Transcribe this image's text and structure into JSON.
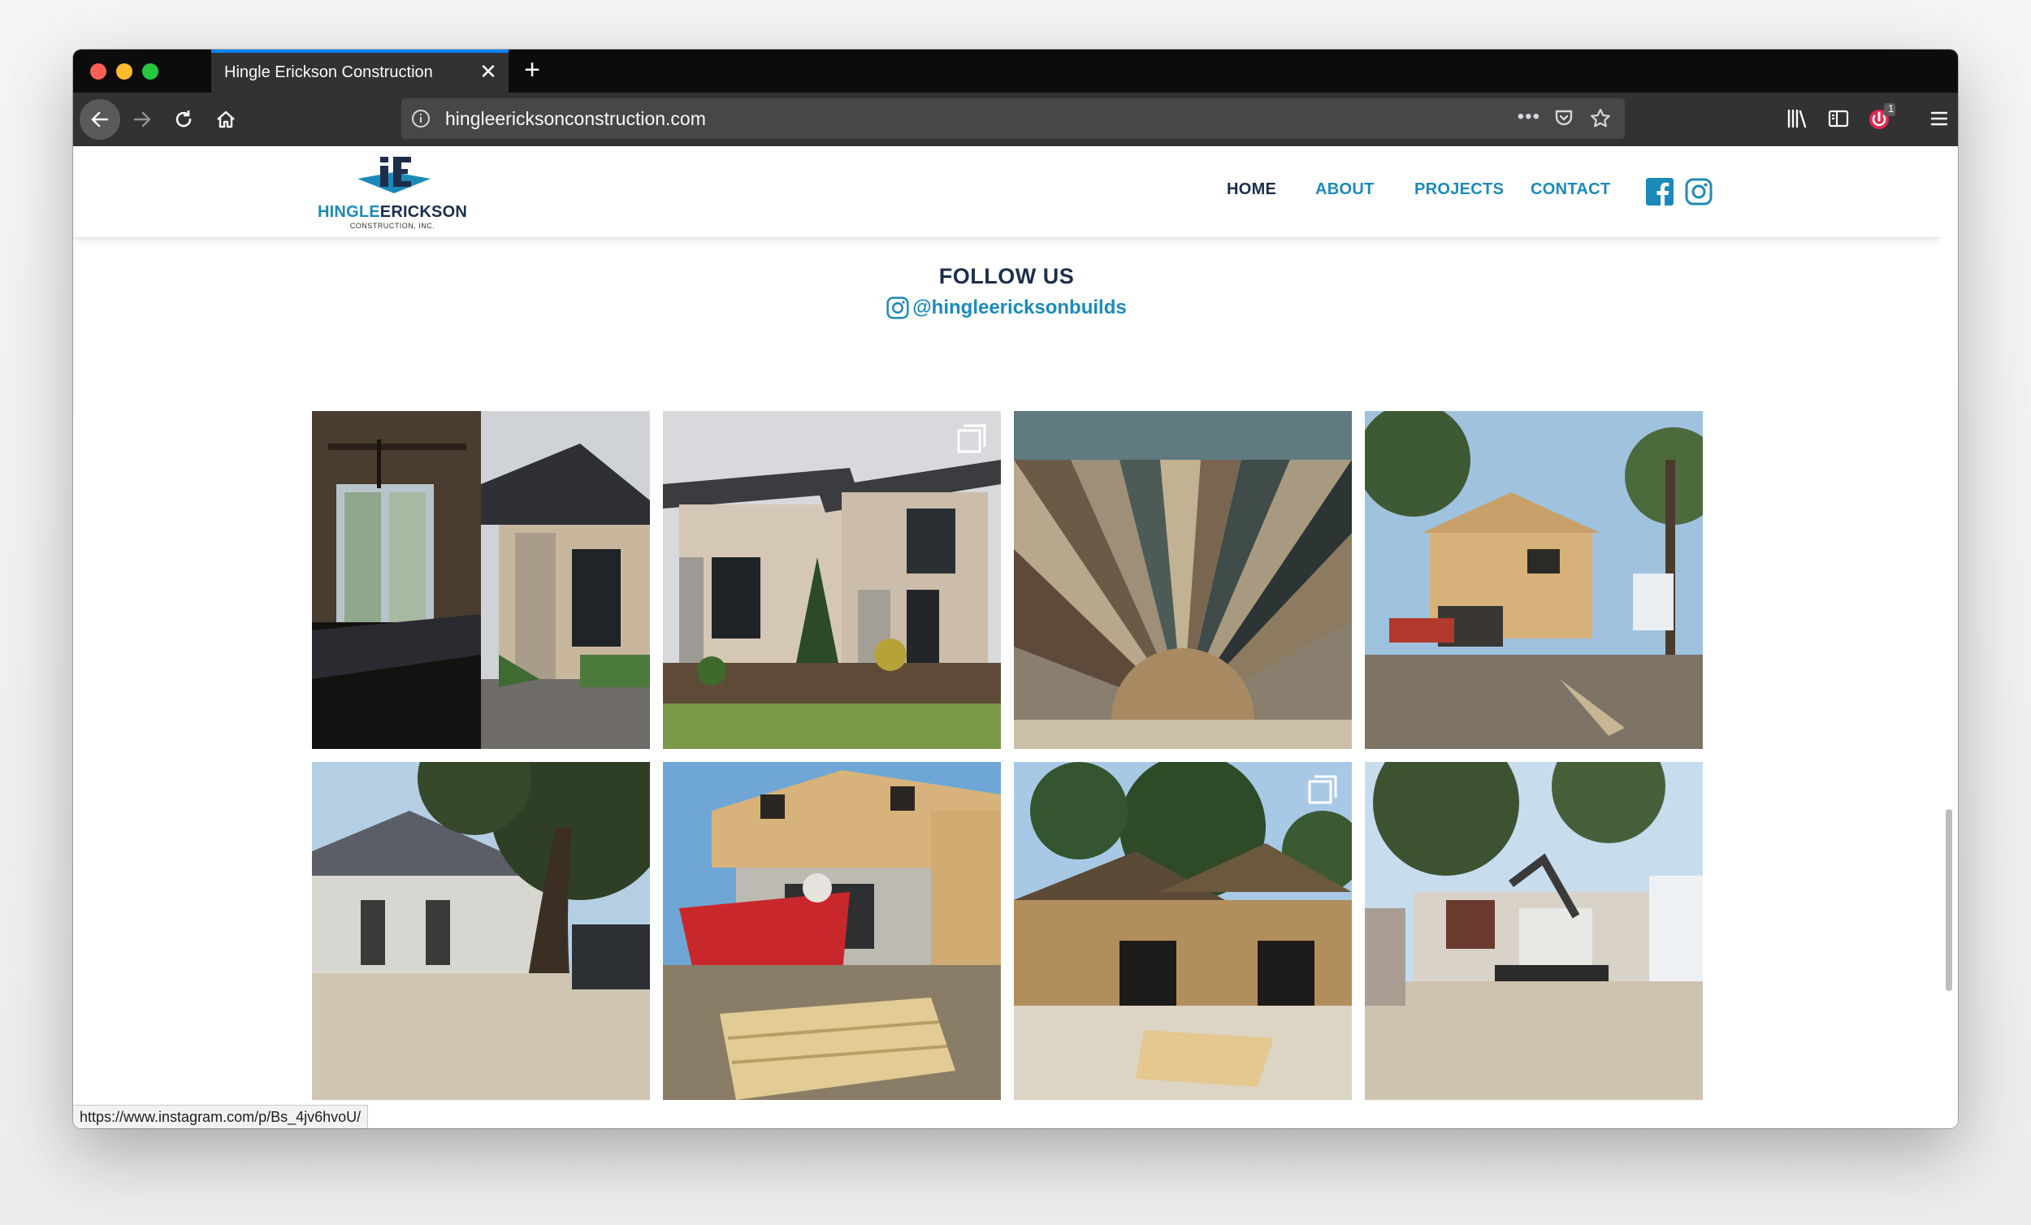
{
  "browser": {
    "tab_title": "Hingle Erickson Construction",
    "url": "hingleericksonconstruction.com",
    "more_glyph": "•••",
    "notification_badge": "1",
    "status_url": "https://www.instagram.com/p/Bs_4jv6hvoU/",
    "accent": "#0a84ff"
  },
  "site": {
    "logo": {
      "part1": "HINGLE",
      "part2": "ERICKSON",
      "sub": "CONSTRUCTION, INC."
    },
    "nav": [
      {
        "label": "HOME",
        "active": true
      },
      {
        "label": "ABOUT",
        "active": false
      },
      {
        "label": "PROJECTS",
        "active": false
      },
      {
        "label": "CONTACT",
        "active": false
      }
    ],
    "social": [
      "facebook-icon",
      "instagram-icon"
    ],
    "colors": {
      "navy": "#1c2e4a",
      "teal": "#1c8ab8"
    }
  },
  "follow": {
    "title": "FOLLOW US",
    "handle": "@hingleericksonbuilds"
  },
  "gallery": [
    {
      "scene": "kitchen-and-exterior-split",
      "multi": false
    },
    {
      "scene": "modern-stone-house",
      "multi": true
    },
    {
      "scene": "reclaimed-wood-sunburst",
      "multi": false
    },
    {
      "scene": "two-story-framing",
      "multi": false
    },
    {
      "scene": "house-with-oak-tree",
      "multi": false
    },
    {
      "scene": "dumpster-and-lumber",
      "multi": false
    },
    {
      "scene": "garage-framing",
      "multi": true
    },
    {
      "scene": "demolition-excavator",
      "multi": false
    }
  ]
}
